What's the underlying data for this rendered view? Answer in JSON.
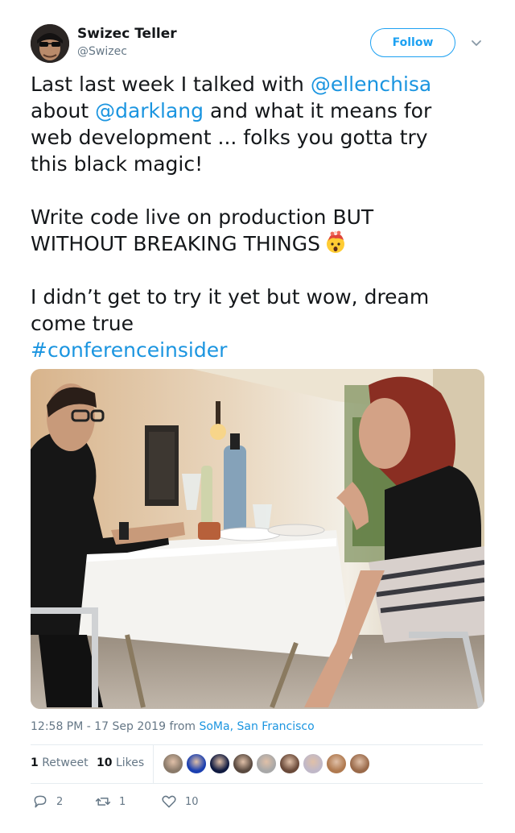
{
  "author": {
    "name": "Swizec Teller",
    "handle": "@Swizec"
  },
  "follow_label": "Follow",
  "tweet": {
    "line1_text": "Last last week I talked with ",
    "line1_mention": "@ellenchisa",
    "line2_text_a": "about ",
    "line2_mention": "@darklang",
    "line2_text_b": " and what it means for",
    "line3": "web development ... folks you gotta try",
    "line4": "this black magic!",
    "line5": "Write code live on production BUT",
    "line6": "WITHOUT BREAKING THINGS",
    "emoji_icon": "exploding-head-icon",
    "line7": "I didn’t get to try it yet but wow, dream",
    "line8": "come true",
    "hashtag": "#conferenceinsider"
  },
  "meta": {
    "timestamp": "12:58 PM - 17 Sep 2019 from ",
    "location": "SoMa, San Francisco"
  },
  "stats": {
    "retweets_count": "1",
    "retweets_label": "Retweet",
    "likes_count": "10",
    "likes_label": "Likes",
    "liker_avatar_colors": [
      "#8a7a6a",
      "#1b3fb0",
      "#101a40",
      "#5a4a40",
      "#a8a8a8",
      "#6a4a3a",
      "#c0b8c8",
      "#b07a50",
      "#9a6a4a"
    ]
  },
  "actions": {
    "reply_count": "2",
    "retweet_count": "1",
    "like_count": "10"
  },
  "colors": {
    "link": "#1b95e0",
    "follow": "#1da1f2",
    "secondary_text": "#657786"
  }
}
